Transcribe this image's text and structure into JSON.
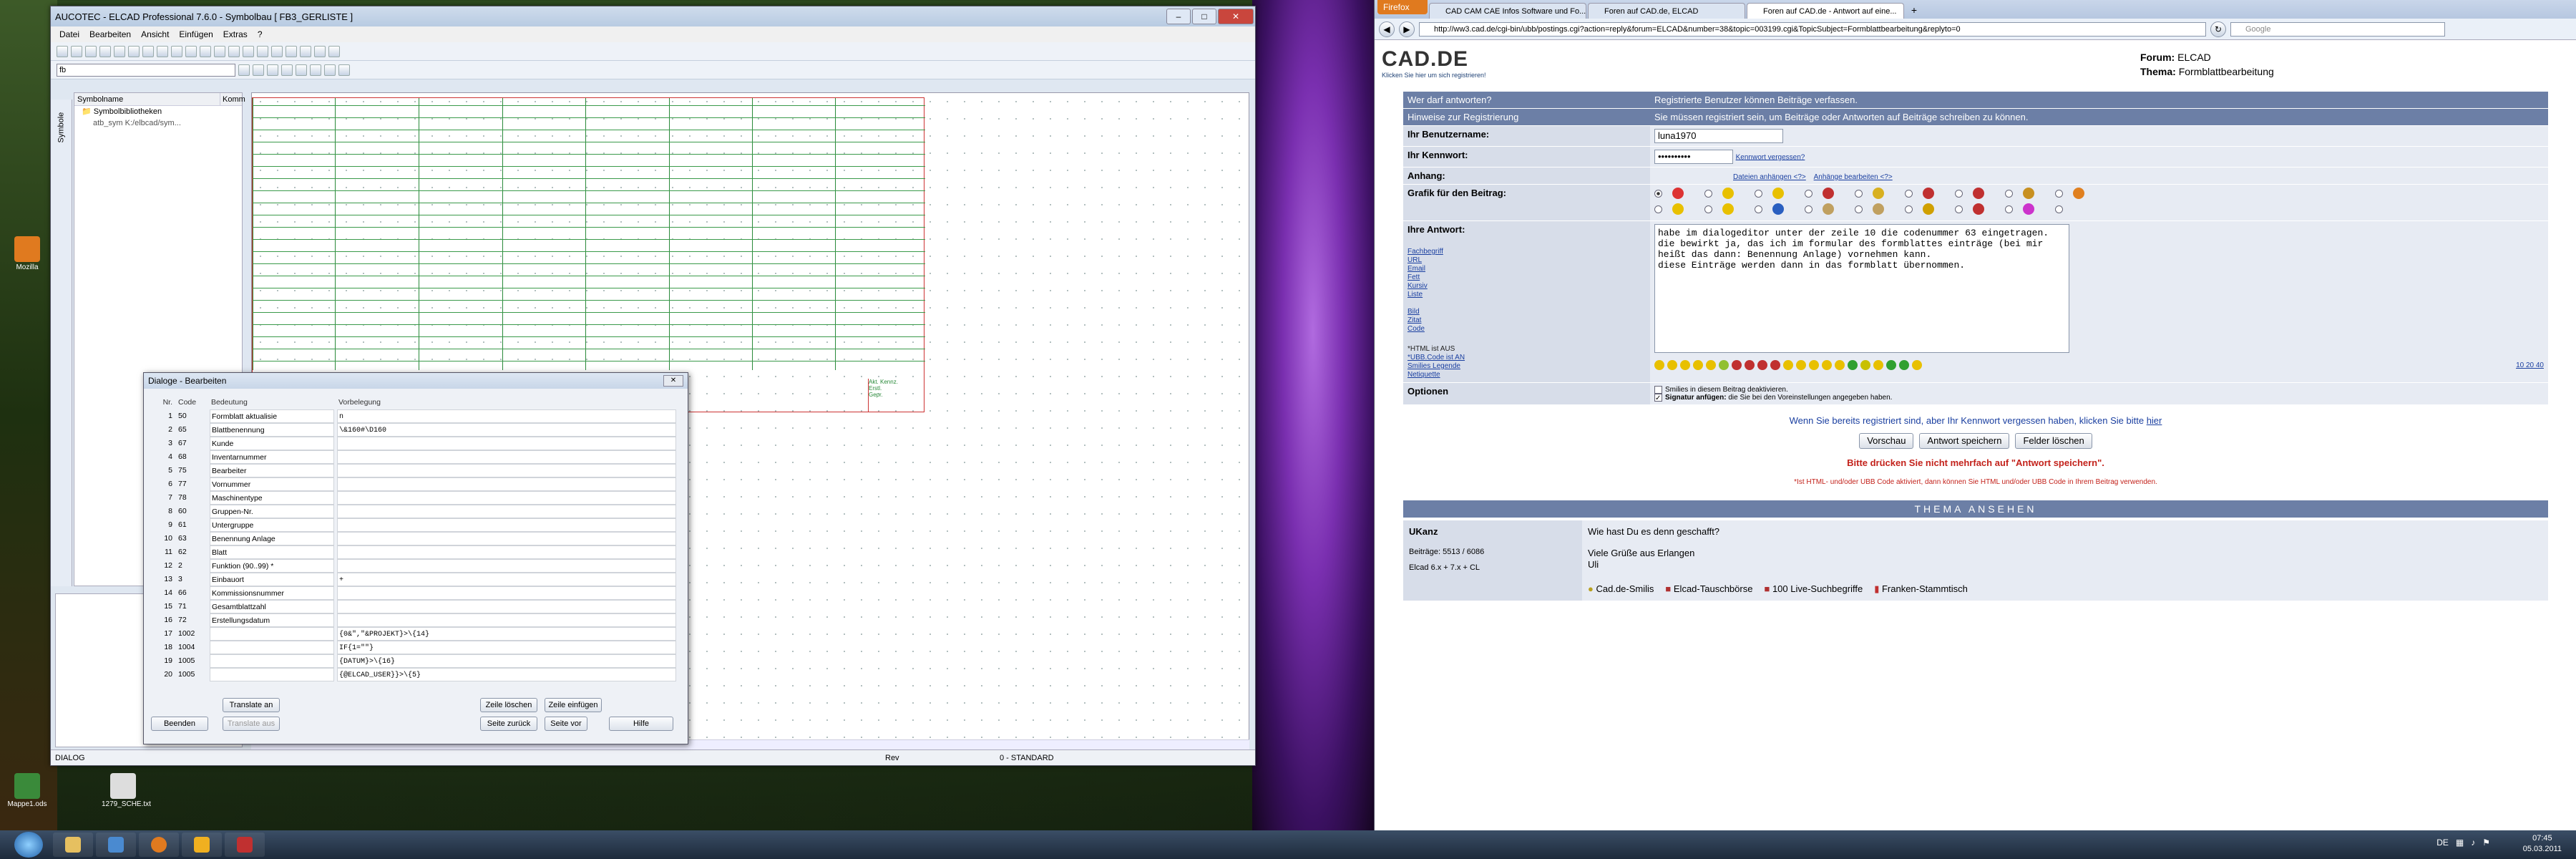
{
  "desktop": {
    "icons": [
      "Mozilla",
      "Mappe1.ods",
      "1279_SCHE.txt"
    ]
  },
  "elcad": {
    "title": "AUCOTEC - ELCAD Professional 7.6.0 - Symbolbau [ FB3_GERLISTE ]",
    "menu": [
      "Datei",
      "Bearbeiten",
      "Ansicht",
      "Einfügen",
      "Extras",
      "?"
    ],
    "layer_select": "fb",
    "side_tab": "Symbole",
    "sym_headers": [
      "Symbolname",
      "Komm"
    ],
    "sym_rows": [
      "Symbolbibliotheken",
      "atb_sym   K:/elbcad/sym..."
    ],
    "canvas_text": [
      "iste",
      "st"
    ],
    "legend": [
      "Akt. Kennz.",
      "Erstl.",
      "Gepr."
    ],
    "status_left": "DIALOG",
    "status_mid": "Rev",
    "status_right": "0 - STANDARD"
  },
  "dialog": {
    "title": "Dialoge - Bearbeiten",
    "headers": {
      "nr": "Nr.",
      "code": "Code",
      "bedeutung": "Bedeutung",
      "vorbelegung": "Vorbelegung"
    },
    "rows": [
      {
        "nr": "1",
        "code": "50",
        "bed": "Formblatt aktualisie",
        "vor": "n"
      },
      {
        "nr": "2",
        "code": "65",
        "bed": "Blattbenennung",
        "vor": "\\&160#\\D160"
      },
      {
        "nr": "3",
        "code": "67",
        "bed": "Kunde",
        "vor": ""
      },
      {
        "nr": "4",
        "code": "68",
        "bed": "Inventarnummer",
        "vor": ""
      },
      {
        "nr": "5",
        "code": "75",
        "bed": "Bearbeiter",
        "vor": ""
      },
      {
        "nr": "6",
        "code": "77",
        "bed": "Vornummer",
        "vor": ""
      },
      {
        "nr": "7",
        "code": "78",
        "bed": "Maschinentype",
        "vor": ""
      },
      {
        "nr": "8",
        "code": "60",
        "bed": "Gruppen-Nr.",
        "vor": ""
      },
      {
        "nr": "9",
        "code": "61",
        "bed": "Untergruppe",
        "vor": ""
      },
      {
        "nr": "10",
        "code": "63",
        "bed": "Benennung Anlage",
        "vor": ""
      },
      {
        "nr": "11",
        "code": "62",
        "bed": "Blatt",
        "vor": ""
      },
      {
        "nr": "12",
        "code": "2",
        "bed": "Funktion (90..99)  *",
        "vor": ""
      },
      {
        "nr": "13",
        "code": "3",
        "bed": "Einbauort",
        "vor": "+"
      },
      {
        "nr": "14",
        "code": "66",
        "bed": "Kommissionsnummer",
        "vor": ""
      },
      {
        "nr": "15",
        "code": "71",
        "bed": "Gesamtblattzahl",
        "vor": ""
      },
      {
        "nr": "16",
        "code": "72",
        "bed": "Erstellungsdatum",
        "vor": ""
      },
      {
        "nr": "17",
        "code": "1002",
        "bed": "",
        "vor": "{0&\",\"&PROJEKT}>\\{14}"
      },
      {
        "nr": "18",
        "code": "1004",
        "bed": "",
        "vor": "IF{1=\"\"}"
      },
      {
        "nr": "19",
        "code": "1005",
        "bed": "",
        "vor": "{DATUM}>\\{16}"
      },
      {
        "nr": "20",
        "code": "1005",
        "bed": "",
        "vor": "{@ELCAD_USER}}>\\{5}"
      }
    ],
    "buttons": {
      "translate_an": "Translate an",
      "beenden": "Beenden",
      "translate_aus": "Translate aus",
      "zeile_loeschen": "Zeile löschen",
      "zeile_einfuegen": "Zeile einfügen",
      "seite_zurueck": "Seite zurück",
      "seite_vor": "Seite vor",
      "hilfe": "Hilfe"
    }
  },
  "firefox": {
    "menu": "Firefox",
    "tabs": [
      "CAD CAM CAE Infos Software und Fo...",
      "Foren auf CAD.de, ELCAD",
      "Foren auf CAD.de - Antwort auf eine..."
    ],
    "url": "http://ww3.cad.de/cgi-bin/ubb/postings.cgi?action=reply&forum=ELCAD&number=38&topic=003199.cgi&TopicSubject=Formblattbearbeitung&replyto=0",
    "search_placeholder": "Google",
    "logo": "CAD.DE",
    "logo_link": "Klicken Sie hier um sich registrieren!",
    "forum_label": "Forum:",
    "forum_value": "ELCAD",
    "thema_label": "Thema:",
    "thema_value": "Formblattbearbeitung",
    "who_label": "Wer darf antworten?",
    "who_value": "Registrierte Benutzer können Beiträge verfassen.",
    "hint_label": "Hinweise zur Registrierung",
    "hint_value": "Sie müssen registriert sein, um Beiträge oder Antworten auf Beiträge schreiben zu können.",
    "user_label": "Ihr Benutzername:",
    "user_value": "luna1970",
    "pw_label": "Ihr Kennwort:",
    "pw_value": "••••••••••",
    "pw_forgot": "Kennwort vergessen?",
    "attach_label": "Anhang:",
    "attach_links": [
      "Dateien anhängen <?>",
      "Anhänge bearbeiten <?>"
    ],
    "grafik_label": "Grafik für den Beitrag:",
    "answer_label": "Ihre Antwort:",
    "answer_text": "habe im dialogeditor unter der zeile 10 die codenummer 63 eingetragen.\ndie bewirkt ja, das ich im formular des formblattes einträge (bei mir\nheißt das dann: Benennung Anlage) vornehmen kann.\ndiese Einträge werden dann in das formblatt übernommen.",
    "code_links": [
      "Fachbegriff",
      "URL",
      "Email",
      "Fett",
      "Kursiv",
      "Liste",
      "Bild",
      "Zitat",
      "Code"
    ],
    "html_off": "*HTML ist AUS",
    "ubb_links": [
      "*UBB.Code ist AN",
      "Smilies Legende",
      "Netiquette"
    ],
    "size_links": "10 20 40",
    "options_label": "Optionen",
    "option1": "Smilies in diesem Beitrag deaktivieren.",
    "option2_bold": "Signatur anfügen:",
    "option2": " die Sie bei den Voreinstellungen angegeben haben.",
    "registered_text": "Wenn Sie bereits registriert sind, aber Ihr Kennwort vergessen haben, klicken Sie bitte ",
    "registered_link": "hier",
    "btn_preview": "Vorschau",
    "btn_save": "Antwort speichern",
    "btn_clear": "Felder löschen",
    "warning": "Bitte drücken Sie nicht mehrfach auf \"Antwort speichern\".",
    "note": "*Ist HTML- und/oder UBB Code aktiviert, dann können Sie HTML und/oder UBB Code in Ihrem Beitrag verwenden.",
    "thema_header": "THEMA ANSEHEN",
    "post_author": "UKanz",
    "post_meta1": "Beiträge: 5513 / 6086",
    "post_meta2": "Elcad 6.x + 7.x + CL",
    "post_question": "Wie hast Du es denn geschafft?",
    "post_line1": "Viele Grüße aus Erlangen",
    "post_line2": "Uli",
    "sigs": [
      "Cad.de-Smilis",
      "Elcad-Tauschbörse",
      "100 Live-Suchbegriffe",
      "Franken-Stammtisch"
    ]
  },
  "taskbar": {
    "lang": "DE",
    "time": "07:45",
    "date": "05.03.2011"
  }
}
